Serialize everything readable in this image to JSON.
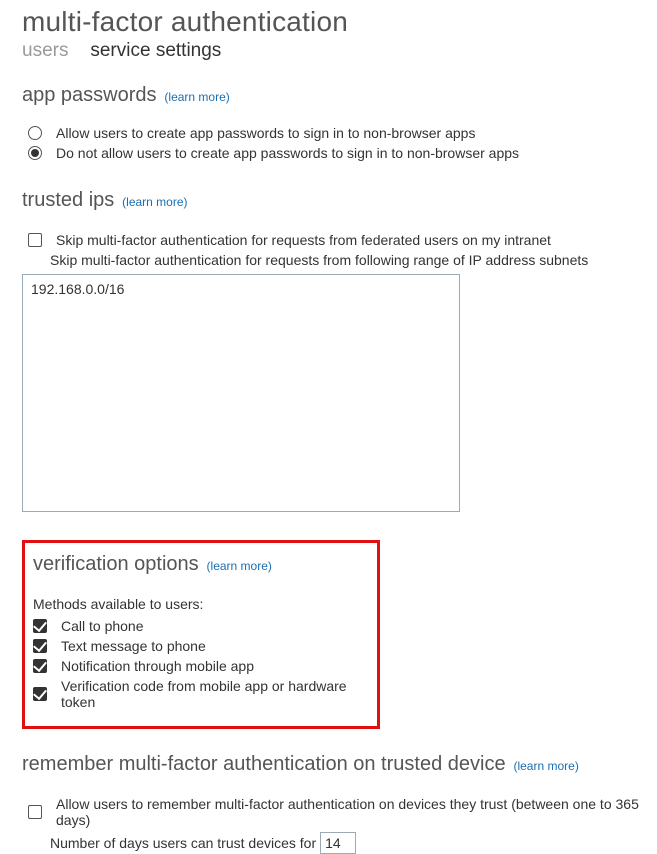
{
  "page": {
    "title": "multi-factor authentication"
  },
  "tabs": {
    "users": "users",
    "service_settings": "service settings",
    "active": "service_settings"
  },
  "learn_more": "(learn more)",
  "app_passwords": {
    "heading": "app passwords",
    "allow_label": "Allow users to create app passwords to sign in to non-browser apps",
    "deny_label": "Do not allow users to create app passwords to sign in to non-browser apps",
    "selected": "deny"
  },
  "trusted_ips": {
    "heading": "trusted ips",
    "skip_federated_label": "Skip multi-factor authentication for requests from federated users on my intranet",
    "skip_federated_checked": false,
    "subnets_label": "Skip multi-factor authentication for requests from following range of IP address subnets",
    "subnets_value": "192.168.0.0/16"
  },
  "verification_options": {
    "heading": "verification options",
    "methods_label": "Methods available to users:",
    "methods": [
      {
        "label": "Call to phone",
        "checked": true
      },
      {
        "label": "Text message to phone",
        "checked": true
      },
      {
        "label": "Notification through mobile app",
        "checked": true
      },
      {
        "label": "Verification code from mobile app or hardware token",
        "checked": true
      }
    ]
  },
  "remember": {
    "heading": "remember multi-factor authentication on trusted device",
    "allow_label": "Allow users to remember multi-factor authentication on devices they trust (between one to 365 days)",
    "allow_checked": false,
    "days_label": "Number of days users can trust devices for",
    "days_value": "14"
  }
}
